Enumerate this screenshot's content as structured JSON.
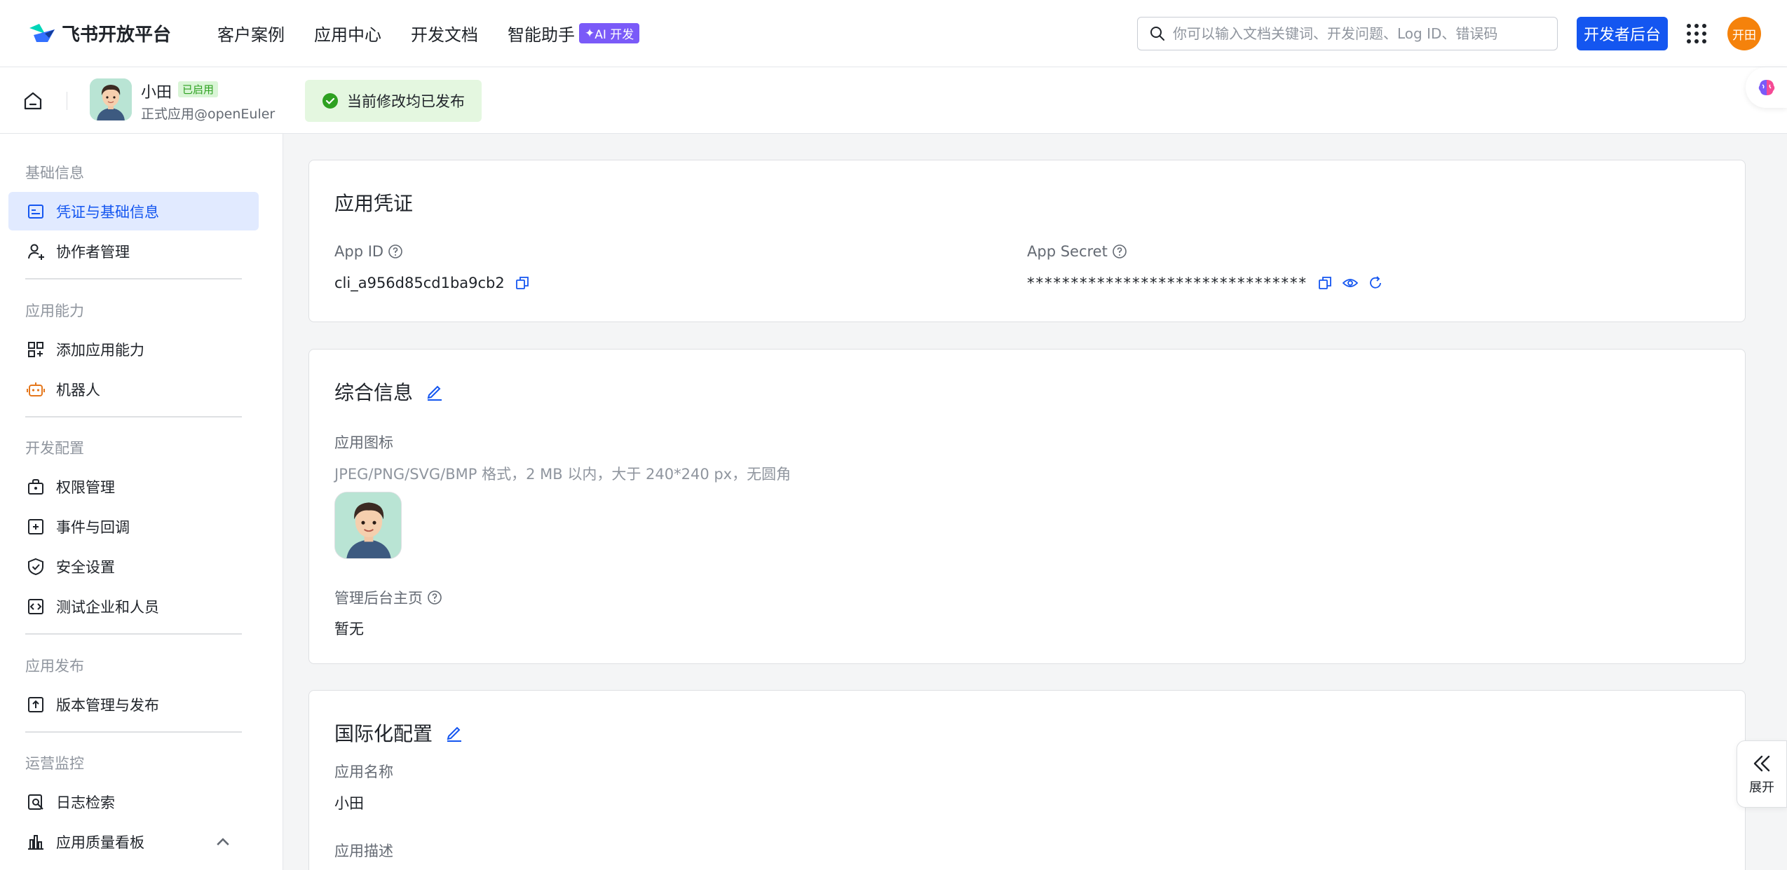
{
  "topnav": {
    "logo_text": "飞书开放平台",
    "items": [
      "客户案例",
      "应用中心",
      "开发文档",
      "智能助手"
    ],
    "ai_badge": "AI 开发",
    "search_placeholder": "你可以输入文档关键词、开发问题、Log ID、错误码",
    "dev_console_button": "开发者后台",
    "user_avatar_text": "开田"
  },
  "subheader": {
    "app_name": "小田",
    "enabled_badge": "已启用",
    "app_type": "正式应用@openEuler",
    "publish_status": "当前修改均已发布"
  },
  "sidebar": {
    "groups": [
      "基础信息",
      "应用能力",
      "开发配置",
      "应用发布",
      "运营监控"
    ],
    "items": [
      {
        "label": "凭证与基础信息",
        "icon": "credential-icon"
      },
      {
        "label": "协作者管理",
        "icon": "user-add-icon"
      },
      {
        "label": "添加应用能力",
        "icon": "apps-add-icon"
      },
      {
        "label": "机器人",
        "icon": "robot-icon"
      },
      {
        "label": "权限管理",
        "icon": "lock-bag-icon"
      },
      {
        "label": "事件与回调",
        "icon": "event-icon"
      },
      {
        "label": "安全设置",
        "icon": "shield-icon"
      },
      {
        "label": "测试企业和人员",
        "icon": "code-box-icon"
      },
      {
        "label": "版本管理与发布",
        "icon": "upload-icon"
      },
      {
        "label": "日志检索",
        "icon": "log-search-icon"
      },
      {
        "label": "应用质量看板",
        "icon": "bar-chart-icon"
      }
    ]
  },
  "credentials": {
    "title": "应用凭证",
    "app_id_label": "App ID",
    "app_id_value": "cli_a956d85cd1ba9cb2",
    "app_secret_label": "App Secret",
    "app_secret_value": "********************************"
  },
  "general": {
    "title": "综合信息",
    "icon_label": "应用图标",
    "icon_hint": "JPEG/PNG/SVG/BMP 格式，2 MB 以内，大于 240*240 px，无圆角",
    "homepage_label": "管理后台主页",
    "homepage_value": "暂无"
  },
  "i18n": {
    "title": "国际化配置",
    "name_label": "应用名称",
    "name_value": "小田",
    "desc_label": "应用描述"
  },
  "expand_button": "展开",
  "colors": {
    "primary": "#1456f0",
    "success": "#2ea121",
    "ai_badge": "#7a5af8",
    "avatar_orange": "#f5820b"
  }
}
